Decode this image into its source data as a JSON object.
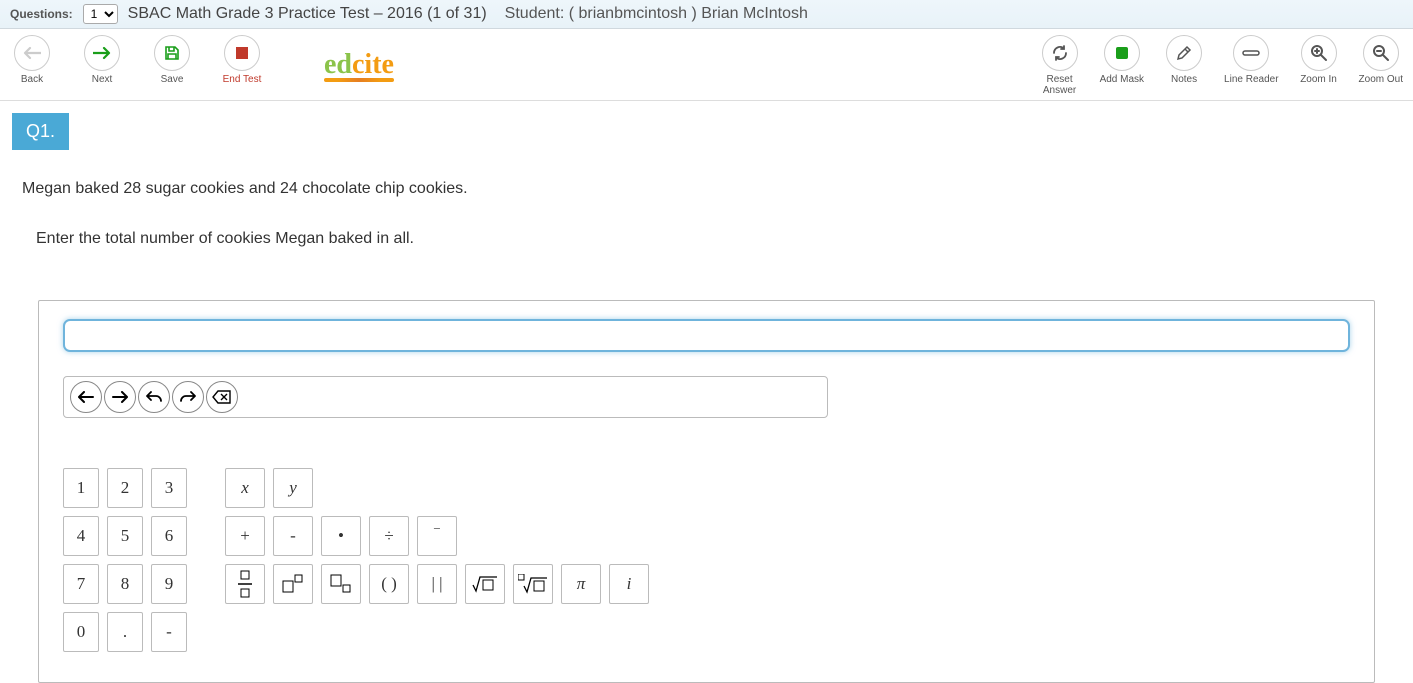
{
  "header": {
    "questions_label": "Questions:",
    "selector_value": "1",
    "test_title": "SBAC Math Grade 3 Practice Test – 2016 (1 of 31)",
    "student_label": "Student: ( brianbmcintosh ) Brian McIntosh"
  },
  "toolbar": {
    "back": "Back",
    "next": "Next",
    "save": "Save",
    "end_test": "End Test",
    "reset_answer": "Reset Answer",
    "add_mask": "Add Mask",
    "notes": "Notes",
    "line_reader": "Line Reader",
    "zoom_in": "Zoom In",
    "zoom_out": "Zoom Out"
  },
  "logo": {
    "part1": "ed",
    "part2": "cite"
  },
  "question": {
    "badge": "Q1.",
    "line1": "Megan baked 28 sugar cookies and 24 chocolate chip cookies.",
    "line2": "Enter the total number of cookies Megan baked in all."
  },
  "keypad": {
    "n1": "1",
    "n2": "2",
    "n3": "3",
    "n4": "4",
    "n5": "5",
    "n6": "6",
    "n7": "7",
    "n8": "8",
    "n9": "9",
    "n0": "0",
    "dot": ".",
    "neg": "-",
    "x": "x",
    "y": "y",
    "plus": "+",
    "minus": "-",
    "mult": "•",
    "div": "÷",
    "sup_minus": "−",
    "frac": "▢/▢",
    "exp": "[]",
    "sub": "[]",
    "paren": "( )",
    "abs": "| |",
    "sqrt": "√[]",
    "nroot": "ⁿ√[]",
    "pi": "π",
    "i": "i"
  }
}
